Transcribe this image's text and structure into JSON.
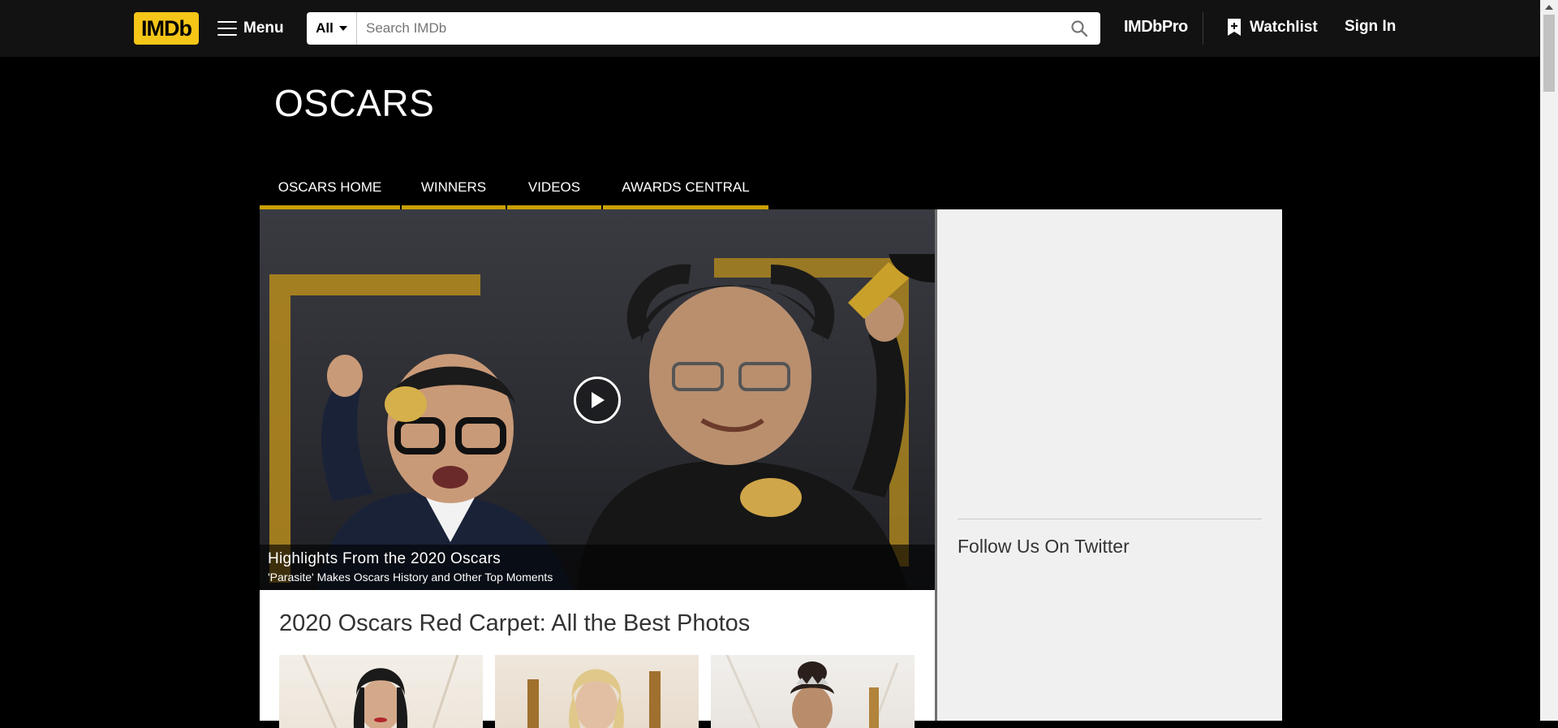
{
  "nav": {
    "logo": "IMDb",
    "menu_label": "Menu",
    "search_category": "All",
    "search_placeholder": "Search IMDb",
    "imdbpro": "IMDbPro",
    "watchlist": "Watchlist",
    "signin": "Sign In"
  },
  "page": {
    "title": "OSCARS"
  },
  "tabs": [
    {
      "label": "OSCARS HOME"
    },
    {
      "label": "WINNERS"
    },
    {
      "label": "VIDEOS"
    },
    {
      "label": "AWARDS CENTRAL"
    }
  ],
  "hero": {
    "title": "Highlights From the 2020 Oscars",
    "subtitle": "'Parasite' Makes Oscars History and Other Top Moments"
  },
  "gallery": {
    "title": "2020 Oscars Red Carpet: All the Best Photos"
  },
  "sidebar": {
    "twitter_title": "Follow Us On Twitter"
  },
  "colors": {
    "brand_yellow": "#f5c518",
    "tab_underline": "#c9a005",
    "navbar_bg": "#121212",
    "page_bg": "#000000"
  },
  "icons": [
    "hamburger-icon",
    "caret-down-icon",
    "search-icon",
    "bookmark-plus-icon",
    "play-icon"
  ]
}
